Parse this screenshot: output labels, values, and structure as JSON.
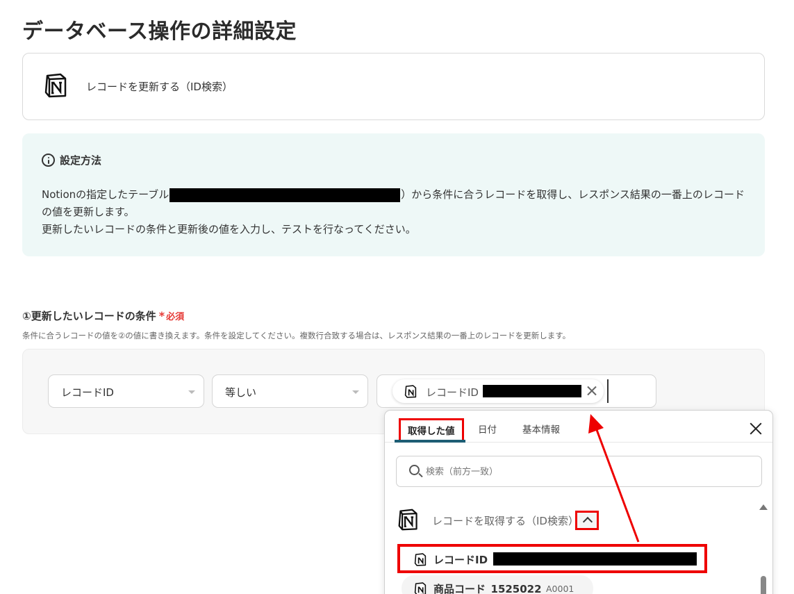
{
  "page": {
    "title": "データベース操作の詳細設定"
  },
  "action": {
    "label": "レコードを更新する（ID検索）",
    "icon": "notion-icon"
  },
  "info": {
    "title": "設定方法",
    "line1_before": "Notionの指定したテーブル",
    "line1_after": "）から条件に合うレコードを取得し、レスポンス結果の一番上のレコード",
    "line2": "の値を更新します。",
    "line3": "更新したいレコードの条件と更新後の値を入力し、テストを行なってください。"
  },
  "section": {
    "title": "①更新したいレコードの条件",
    "required_star": "*",
    "required_label": "必須",
    "description": "条件に合うレコードの値を②の値に書き換えます。条件を設定してください。複数行合致する場合は、レスポンス結果の一番上のレコードを更新します。"
  },
  "condition": {
    "field": "レコードID",
    "operator": "等しい",
    "chip_label": "レコードID"
  },
  "popup": {
    "tabs": [
      "取得した値",
      "日付",
      "基本情報"
    ],
    "search_placeholder": "検索（前方一致）",
    "group_label": "レコードを取得する（ID検索）",
    "items": [
      {
        "label": "レコードID",
        "value": ""
      },
      {
        "label": "商品コード_1525022",
        "value": "A0001"
      }
    ]
  },
  "colors": {
    "highlight": "#e00000",
    "info_bg": "#eef8f7",
    "tab_underline": "#1d5d74"
  }
}
